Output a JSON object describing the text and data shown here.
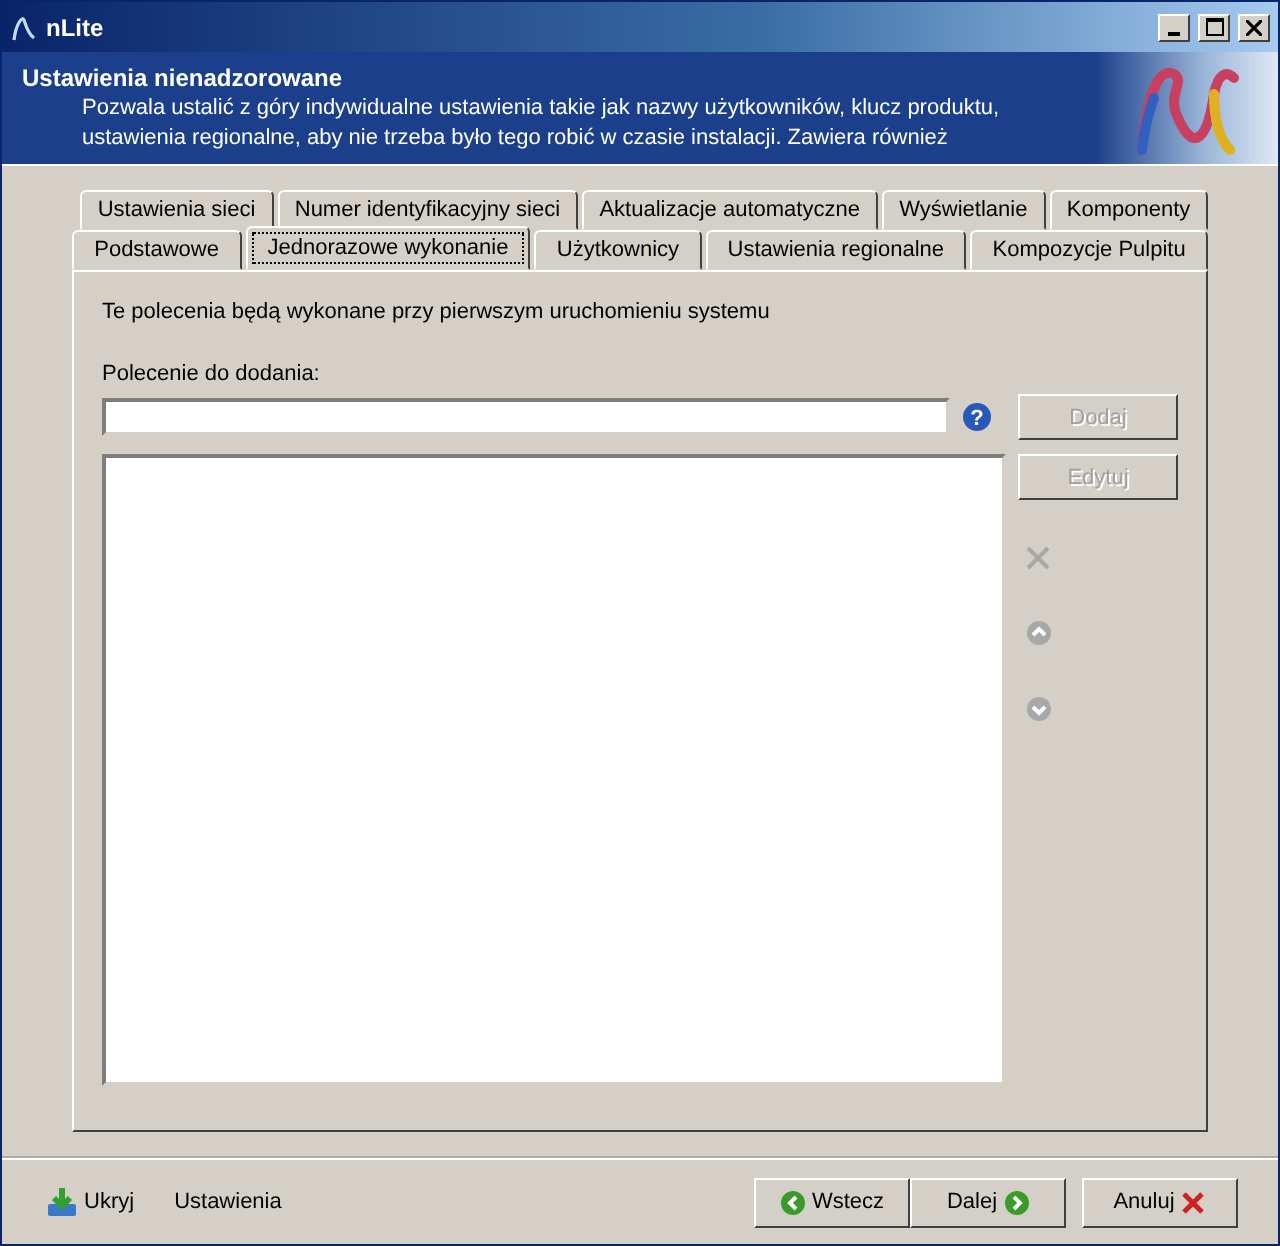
{
  "window": {
    "title": "nLite"
  },
  "header": {
    "title": "Ustawienia nienadzorowane",
    "description": "Pozwala ustalić z góry indywidualne ustawienia takie jak nazwy użytkowników, klucz produktu, ustawienia regionalne, aby nie trzeba było tego robić w czasie instalacji. Zawiera również"
  },
  "tab_rows": [
    [
      {
        "label": "Ustawienia sieci",
        "selected": false
      },
      {
        "label": "Numer identyfikacyjny sieci",
        "selected": false
      },
      {
        "label": "Aktualizacje automatyczne",
        "selected": false
      },
      {
        "label": "Wyświetlanie",
        "selected": false
      },
      {
        "label": "Komponenty",
        "selected": false
      }
    ],
    [
      {
        "label": "Podstawowe",
        "selected": false
      },
      {
        "label": "Jednorazowe wykonanie",
        "selected": true
      },
      {
        "label": "Użytkownicy",
        "selected": false
      },
      {
        "label": "Ustawienia regionalne",
        "selected": false
      },
      {
        "label": "Kompozycje Pulpitu",
        "selected": false
      }
    ]
  ],
  "panel": {
    "intro": "Te polecenia będą wykonane przy pierwszym uruchomieniu systemu",
    "field_label": "Polecenie do dodania:",
    "help": "?",
    "buttons": [
      {
        "label": "Dodaj",
        "disabled": true
      },
      {
        "label": "Edytuj",
        "disabled": true
      }
    ],
    "side_icons": [
      {
        "kind": "remove",
        "disabled": true
      },
      {
        "kind": "up",
        "disabled": true
      },
      {
        "kind": "down",
        "disabled": true
      }
    ]
  },
  "footer": {
    "hide": "Ukryj",
    "settings": "Ustawienia",
    "nav": [
      {
        "kind": "back",
        "label": "Wstecz"
      },
      {
        "kind": "next",
        "label": "Dalej"
      },
      {
        "kind": "cancel",
        "label": "Anuluj"
      }
    ]
  }
}
